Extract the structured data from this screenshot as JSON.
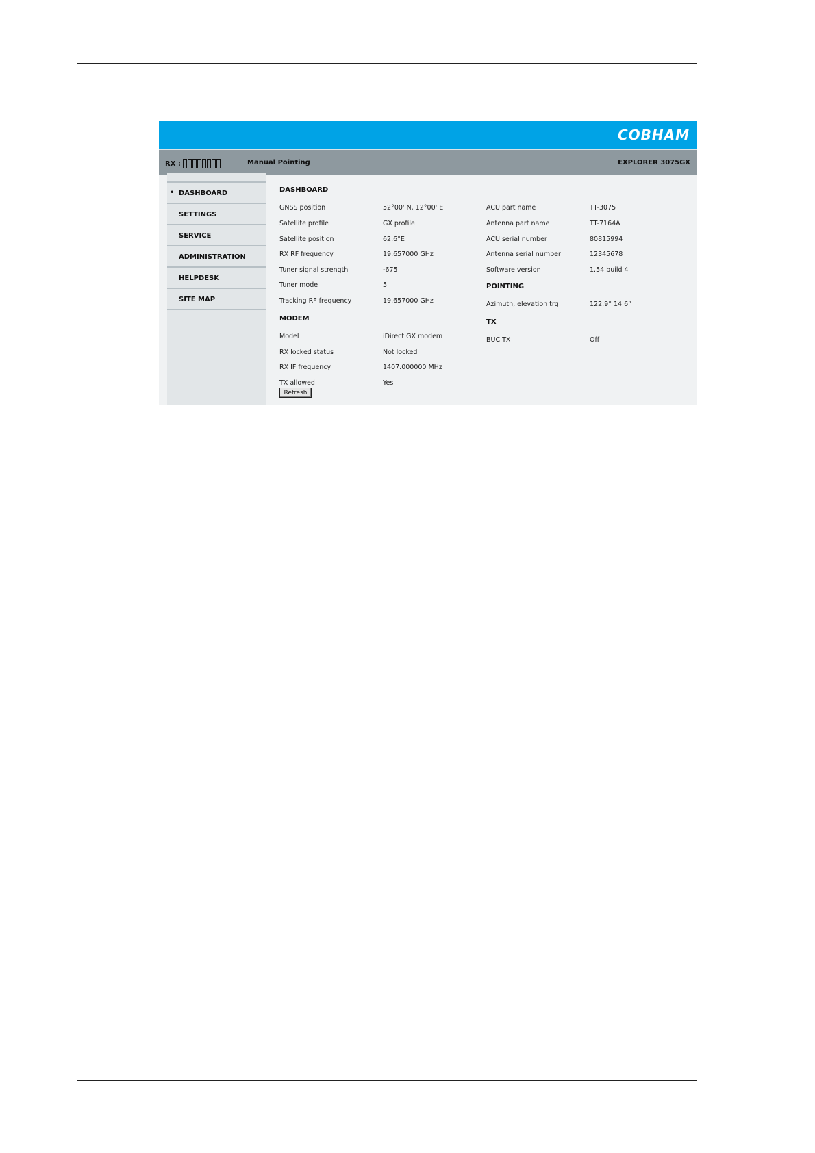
{
  "app": {
    "logo": "COBHAM",
    "rx_label": "RX :",
    "rx_signal_bars": 8,
    "mode": "Manual Pointing",
    "product": "EXPLORER 3075GX"
  },
  "sidebar": {
    "items": [
      {
        "label": "DASHBOARD",
        "active": true
      },
      {
        "label": "SETTINGS"
      },
      {
        "label": "SERVICE"
      },
      {
        "label": "ADMINISTRATION"
      },
      {
        "label": "HELPDESK"
      },
      {
        "label": "SITE MAP"
      }
    ]
  },
  "dashboard": {
    "title": "DASHBOARD",
    "rows": [
      {
        "label": "GNSS position",
        "value": "52°00' N, 12°00' E"
      },
      {
        "label": "Satellite profile",
        "value": "GX profile"
      },
      {
        "label": "Satellite position",
        "value": "62.6°E"
      },
      {
        "label": "RX RF frequency",
        "value": "19.657000 GHz"
      },
      {
        "label": "Tuner signal strength",
        "value": "-675"
      },
      {
        "label": "Tuner mode",
        "value": "5"
      },
      {
        "label": "Tracking RF frequency",
        "value": "19.657000 GHz"
      }
    ]
  },
  "modem": {
    "title": "MODEM",
    "rows": [
      {
        "label": "Model",
        "value": "iDirect GX modem"
      },
      {
        "label": "RX locked status",
        "value": "Not locked"
      },
      {
        "label": "RX IF frequency",
        "value": "1407.000000 MHz"
      },
      {
        "label": "TX allowed",
        "value": "Yes"
      }
    ]
  },
  "info": {
    "rows": [
      {
        "label": "ACU part name",
        "value": "TT-3075"
      },
      {
        "label": "Antenna part name",
        "value": "TT-7164A"
      },
      {
        "label": "ACU serial number",
        "value": "80815994"
      },
      {
        "label": "Antenna serial number",
        "value": "12345678"
      },
      {
        "label": "Software version",
        "value": "1.54 build 4"
      }
    ]
  },
  "pointing": {
    "title": "POINTING",
    "rows": [
      {
        "label": "Azimuth, elevation trg",
        "value": "122.9° 14.6°"
      }
    ]
  },
  "tx": {
    "title": "TX",
    "rows": [
      {
        "label": "BUC TX",
        "value": "Off"
      }
    ]
  },
  "refresh_label": "Refresh"
}
